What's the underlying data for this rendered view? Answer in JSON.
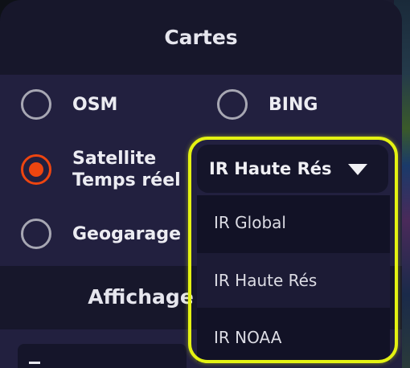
{
  "sections": {
    "maps_title": "Cartes",
    "display_title": "Affichage"
  },
  "map_options": [
    {
      "label": "OSM",
      "checked": false
    },
    {
      "label": "BING",
      "checked": false
    },
    {
      "label_line1": "Satellite",
      "label_line2": "Temps réel",
      "checked": true
    },
    {
      "label": "Geogarage",
      "checked": false
    }
  ],
  "satellite_dropdown": {
    "selected": "IR Haute Rés",
    "options": [
      "IR Global",
      "IR Haute Rés",
      "IR NOAA"
    ]
  },
  "colors": {
    "panel_bg": "#17172b",
    "section_bg": "#22203f",
    "radio_checked": "#ee4510",
    "highlight": "#e4f212"
  }
}
